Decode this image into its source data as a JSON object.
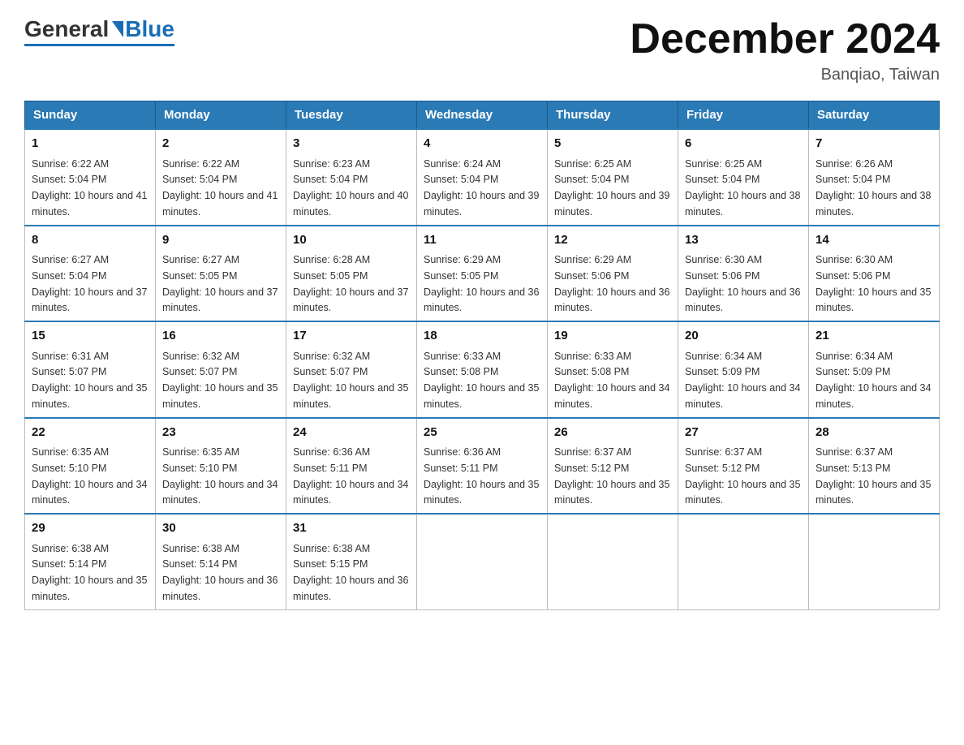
{
  "header": {
    "logo": {
      "general": "General",
      "blue": "Blue"
    },
    "title": "December 2024",
    "location": "Banqiao, Taiwan"
  },
  "days_of_week": [
    "Sunday",
    "Monday",
    "Tuesday",
    "Wednesday",
    "Thursday",
    "Friday",
    "Saturday"
  ],
  "weeks": [
    [
      {
        "day": "1",
        "sunrise": "6:22 AM",
        "sunset": "5:04 PM",
        "daylight": "10 hours and 41 minutes."
      },
      {
        "day": "2",
        "sunrise": "6:22 AM",
        "sunset": "5:04 PM",
        "daylight": "10 hours and 41 minutes."
      },
      {
        "day": "3",
        "sunrise": "6:23 AM",
        "sunset": "5:04 PM",
        "daylight": "10 hours and 40 minutes."
      },
      {
        "day": "4",
        "sunrise": "6:24 AM",
        "sunset": "5:04 PM",
        "daylight": "10 hours and 39 minutes."
      },
      {
        "day": "5",
        "sunrise": "6:25 AM",
        "sunset": "5:04 PM",
        "daylight": "10 hours and 39 minutes."
      },
      {
        "day": "6",
        "sunrise": "6:25 AM",
        "sunset": "5:04 PM",
        "daylight": "10 hours and 38 minutes."
      },
      {
        "day": "7",
        "sunrise": "6:26 AM",
        "sunset": "5:04 PM",
        "daylight": "10 hours and 38 minutes."
      }
    ],
    [
      {
        "day": "8",
        "sunrise": "6:27 AM",
        "sunset": "5:04 PM",
        "daylight": "10 hours and 37 minutes."
      },
      {
        "day": "9",
        "sunrise": "6:27 AM",
        "sunset": "5:05 PM",
        "daylight": "10 hours and 37 minutes."
      },
      {
        "day": "10",
        "sunrise": "6:28 AM",
        "sunset": "5:05 PM",
        "daylight": "10 hours and 37 minutes."
      },
      {
        "day": "11",
        "sunrise": "6:29 AM",
        "sunset": "5:05 PM",
        "daylight": "10 hours and 36 minutes."
      },
      {
        "day": "12",
        "sunrise": "6:29 AM",
        "sunset": "5:06 PM",
        "daylight": "10 hours and 36 minutes."
      },
      {
        "day": "13",
        "sunrise": "6:30 AM",
        "sunset": "5:06 PM",
        "daylight": "10 hours and 36 minutes."
      },
      {
        "day": "14",
        "sunrise": "6:30 AM",
        "sunset": "5:06 PM",
        "daylight": "10 hours and 35 minutes."
      }
    ],
    [
      {
        "day": "15",
        "sunrise": "6:31 AM",
        "sunset": "5:07 PM",
        "daylight": "10 hours and 35 minutes."
      },
      {
        "day": "16",
        "sunrise": "6:32 AM",
        "sunset": "5:07 PM",
        "daylight": "10 hours and 35 minutes."
      },
      {
        "day": "17",
        "sunrise": "6:32 AM",
        "sunset": "5:07 PM",
        "daylight": "10 hours and 35 minutes."
      },
      {
        "day": "18",
        "sunrise": "6:33 AM",
        "sunset": "5:08 PM",
        "daylight": "10 hours and 35 minutes."
      },
      {
        "day": "19",
        "sunrise": "6:33 AM",
        "sunset": "5:08 PM",
        "daylight": "10 hours and 34 minutes."
      },
      {
        "day": "20",
        "sunrise": "6:34 AM",
        "sunset": "5:09 PM",
        "daylight": "10 hours and 34 minutes."
      },
      {
        "day": "21",
        "sunrise": "6:34 AM",
        "sunset": "5:09 PM",
        "daylight": "10 hours and 34 minutes."
      }
    ],
    [
      {
        "day": "22",
        "sunrise": "6:35 AM",
        "sunset": "5:10 PM",
        "daylight": "10 hours and 34 minutes."
      },
      {
        "day": "23",
        "sunrise": "6:35 AM",
        "sunset": "5:10 PM",
        "daylight": "10 hours and 34 minutes."
      },
      {
        "day": "24",
        "sunrise": "6:36 AM",
        "sunset": "5:11 PM",
        "daylight": "10 hours and 34 minutes."
      },
      {
        "day": "25",
        "sunrise": "6:36 AM",
        "sunset": "5:11 PM",
        "daylight": "10 hours and 35 minutes."
      },
      {
        "day": "26",
        "sunrise": "6:37 AM",
        "sunset": "5:12 PM",
        "daylight": "10 hours and 35 minutes."
      },
      {
        "day": "27",
        "sunrise": "6:37 AM",
        "sunset": "5:12 PM",
        "daylight": "10 hours and 35 minutes."
      },
      {
        "day": "28",
        "sunrise": "6:37 AM",
        "sunset": "5:13 PM",
        "daylight": "10 hours and 35 minutes."
      }
    ],
    [
      {
        "day": "29",
        "sunrise": "6:38 AM",
        "sunset": "5:14 PM",
        "daylight": "10 hours and 35 minutes."
      },
      {
        "day": "30",
        "sunrise": "6:38 AM",
        "sunset": "5:14 PM",
        "daylight": "10 hours and 36 minutes."
      },
      {
        "day": "31",
        "sunrise": "6:38 AM",
        "sunset": "5:15 PM",
        "daylight": "10 hours and 36 minutes."
      },
      null,
      null,
      null,
      null
    ]
  ],
  "labels": {
    "sunrise": "Sunrise:",
    "sunset": "Sunset:",
    "daylight": "Daylight:"
  }
}
